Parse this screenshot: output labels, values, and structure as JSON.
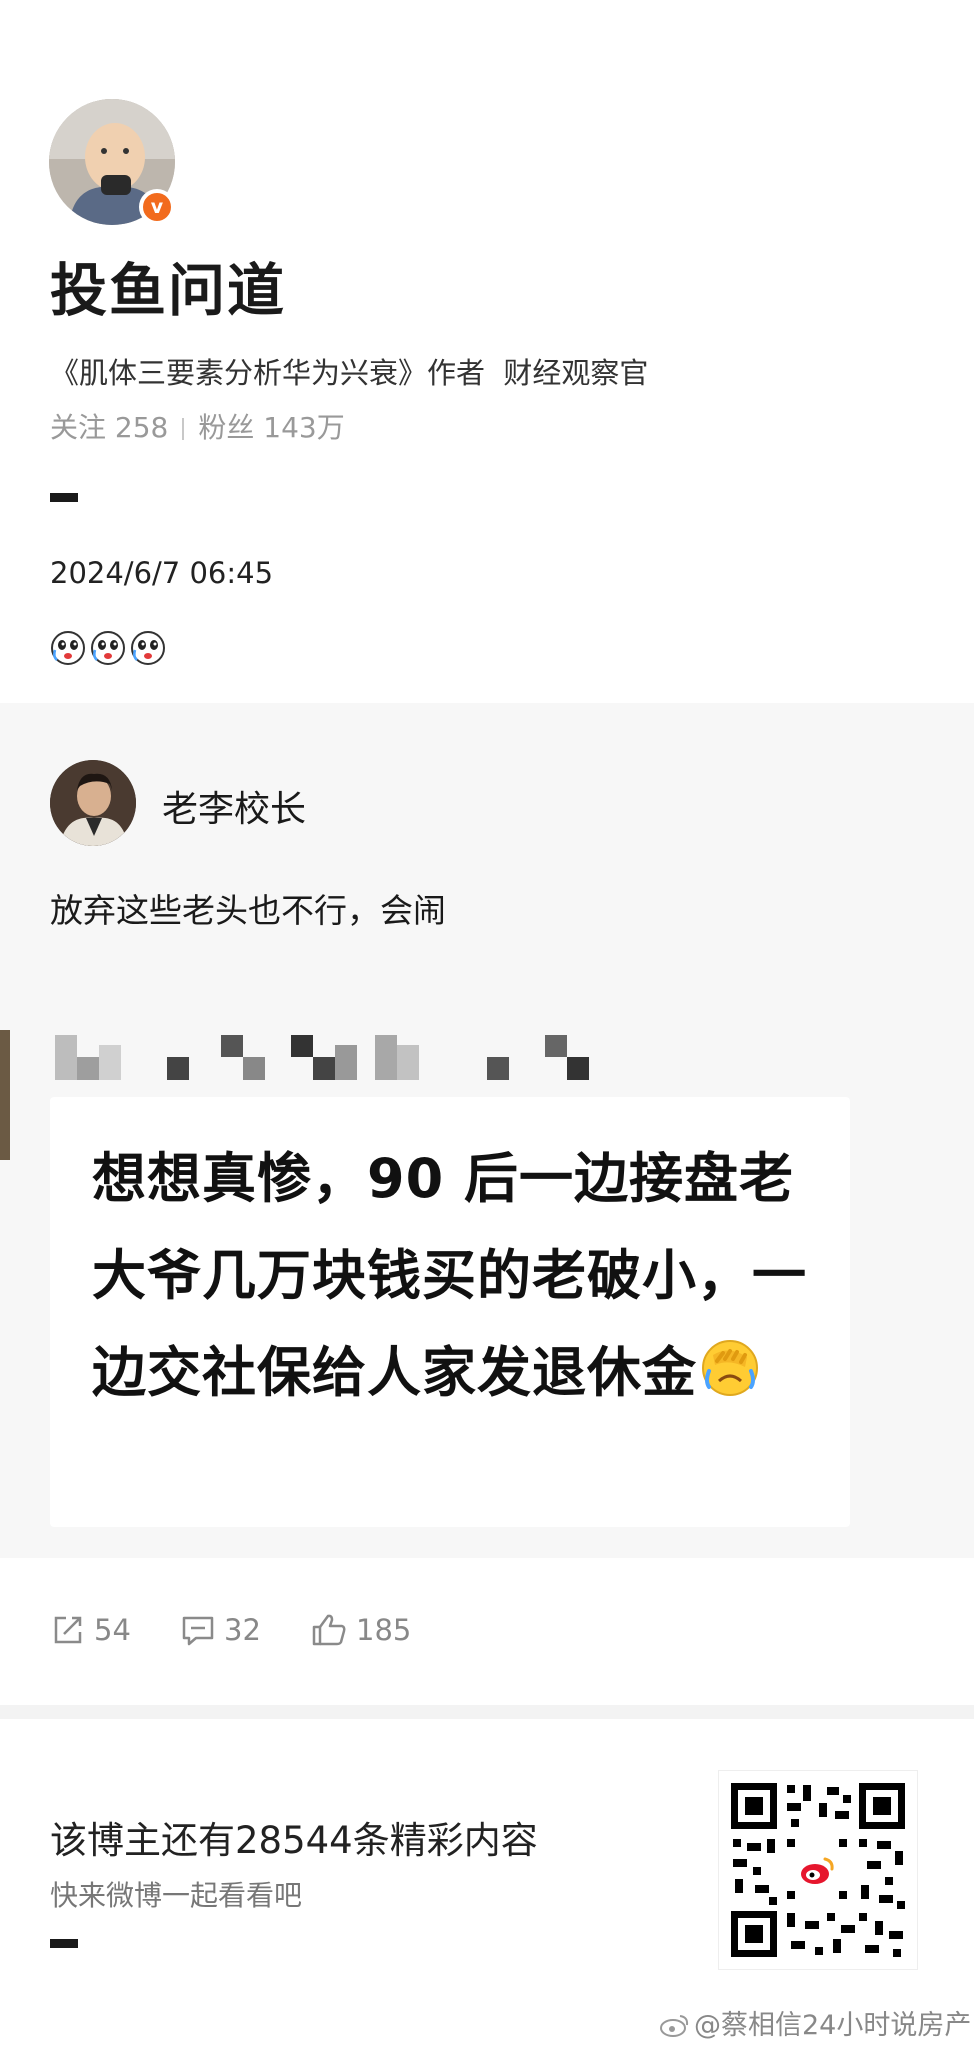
{
  "profile": {
    "name": "投鱼问道",
    "verified_badge": "v",
    "bio": "《肌体三要素分析华为兴衰》作者  财经观察官",
    "following_label": "关注",
    "following_count": "258",
    "followers_label": "粉丝",
    "followers_count": "143万"
  },
  "post": {
    "timestamp": "2024/6/7 06:45",
    "emojis": [
      "sad-face-emoji",
      "sad-face-emoji",
      "sad-face-emoji"
    ]
  },
  "comment": {
    "author": "老李校长",
    "text": "放弃这些老头也不行，会闹"
  },
  "quoted_image": {
    "text": "想想真惨，90 后一边接盘老大爷几万块钱买的老破小，一边交社保给人家发退休金",
    "emoji": "facepalm-crying-emoji"
  },
  "actions": {
    "repost_count": "54",
    "comment_count": "32",
    "like_count": "185"
  },
  "footer": {
    "more_title": "该博主还有28544条精彩内容",
    "more_subtitle": "快来微博一起看看吧",
    "watermark": "@蔡相信24小时说房产"
  },
  "colors": {
    "verified_orange": "#f26b1d",
    "muted_gray": "#999999",
    "block_background": "#f7f7f7"
  }
}
